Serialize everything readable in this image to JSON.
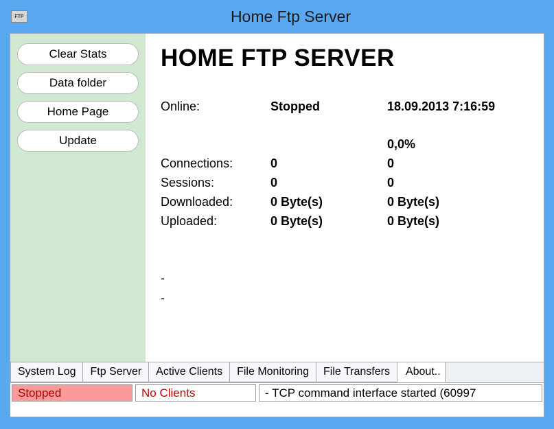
{
  "app": {
    "icon_label": "FTP",
    "title": "Home Ftp Server"
  },
  "sidebar": {
    "buttons": {
      "clear_stats": "Clear Stats",
      "data_folder": "Data folder",
      "home_page": "Home Page",
      "update": "Update"
    }
  },
  "content": {
    "heading": "HOME FTP SERVER",
    "stats": {
      "online_label": "Online:",
      "online_value": "Stopped",
      "online_time": "18.09.2013 7:16:59",
      "percent": "0,0%",
      "connections_label": "Connections:",
      "connections_value": "0",
      "connections_secondary": "0",
      "sessions_label": "Sessions:",
      "sessions_value": "0",
      "sessions_secondary": "0",
      "downloaded_label": "Downloaded:",
      "downloaded_value": "0 Byte(s)",
      "downloaded_secondary": "0 Byte(s)",
      "uploaded_label": "Uploaded:",
      "uploaded_value": "0 Byte(s)",
      "uploaded_secondary": "0 Byte(s)"
    },
    "dash1": "-",
    "dash2": "-"
  },
  "tabs": {
    "system_log": "System Log",
    "ftp_server": "Ftp Server",
    "active_clients": "Active Clients",
    "file_monitoring": "File Monitoring",
    "file_transfers": "File Transfers",
    "about": "About.."
  },
  "status": {
    "state": "Stopped",
    "clients": "No Clients",
    "log": "- TCP command interface started (60997"
  }
}
